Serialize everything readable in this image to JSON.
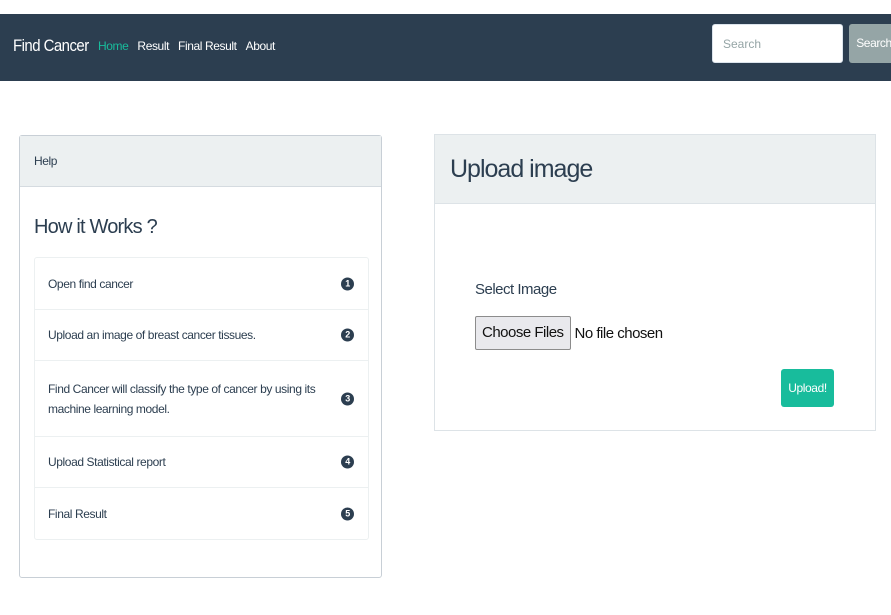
{
  "navbar": {
    "brand": "Find Cancer",
    "links": [
      "Home",
      "Result",
      "Final Result",
      "About"
    ],
    "active_index": 0,
    "search": {
      "placeholder": "Search",
      "value": "",
      "button_label": "Search"
    }
  },
  "help_panel": {
    "header": "Help",
    "title": "How it Works ?",
    "steps": [
      {
        "text": "Open find cancer",
        "number": "1"
      },
      {
        "text": "Upload an image of breast cancer tissues.",
        "number": "2"
      },
      {
        "text": "Find Cancer will classify the type of cancer by using its machine learning model.",
        "number": "3"
      },
      {
        "text": "Upload Statistical report",
        "number": "4"
      },
      {
        "text": "Final Result",
        "number": "5"
      }
    ]
  },
  "upload_panel": {
    "title": "Upload image",
    "label": "Select Image",
    "choose_button": "Choose Files",
    "file_status": "No file chosen",
    "submit_button": "Upload!"
  },
  "colors": {
    "navbar_bg": "#2c3e50",
    "accent": "#18bc9c",
    "search_button": "#95a5a6",
    "panel_header_bg": "#ecf0f1"
  }
}
